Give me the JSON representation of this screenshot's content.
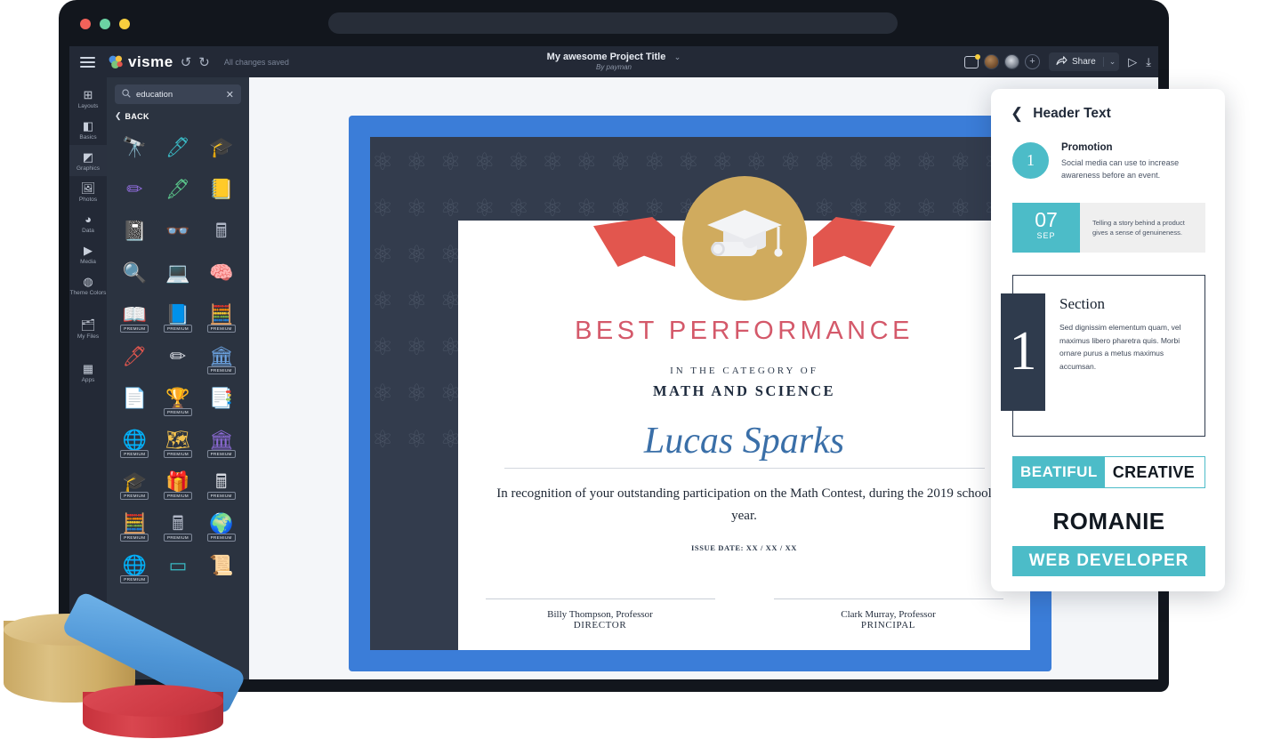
{
  "window": {
    "traffic_lights": [
      "close-red",
      "minimize-green",
      "maximize-yellow"
    ],
    "url_value": ""
  },
  "topbar": {
    "menu_icon": "hamburger-icon",
    "brand": "visme",
    "undo_icon": "↺",
    "redo_icon": "↻",
    "save_status": "All changes saved",
    "project_title": "My awesome Project Title",
    "project_caret": "⌄",
    "project_subtitle": "By payman",
    "comment_icon": "comment-icon",
    "add_user_icon": "+",
    "share_label": "Share",
    "share_caret": "⌄",
    "preview_icon": "▷",
    "download_icon": "⤓"
  },
  "rail": {
    "items": [
      {
        "label": "Layouts",
        "icon": "⊞",
        "active": false
      },
      {
        "label": "Basics",
        "icon": "◧",
        "active": false
      },
      {
        "label": "Graphics",
        "icon": "◩",
        "active": true
      },
      {
        "label": "Photos",
        "icon": "🖼",
        "active": false
      },
      {
        "label": "Data",
        "icon": "◕",
        "active": false
      },
      {
        "label": "Media",
        "icon": "▶",
        "active": false
      },
      {
        "label": "Theme Colors",
        "icon": "◍",
        "active": false
      },
      {
        "label": "My Files",
        "icon": "🗂",
        "active": false
      },
      {
        "label": "Apps",
        "icon": "▦",
        "active": false
      }
    ]
  },
  "assets": {
    "search_value": "education",
    "search_placeholder": "Search",
    "search_icon": "search-icon",
    "clear_icon": "✕",
    "back_label": "BACK",
    "back_icon": "chevron-left-icon",
    "premium_badge": "PREMIUM",
    "items": [
      {
        "name": "telescope-icon",
        "glyph": "🔭",
        "premium": false
      },
      {
        "name": "pen-icon",
        "glyph": "🖊",
        "premium": false
      },
      {
        "name": "graduation-cap-icon",
        "glyph": "🎓",
        "premium": false
      },
      {
        "name": "pencil-icon",
        "glyph": "✏",
        "premium": false
      },
      {
        "name": "fountain-pen-icon",
        "glyph": "🖋",
        "premium": false
      },
      {
        "name": "books-stack-icon",
        "glyph": "📒",
        "premium": false
      },
      {
        "name": "notebook-icon",
        "glyph": "📓",
        "premium": false
      },
      {
        "name": "glasses-icon",
        "glyph": "👓",
        "premium": false
      },
      {
        "name": "calculator-icon",
        "glyph": "🖩",
        "premium": false
      },
      {
        "name": "research-icon",
        "glyph": "🔍",
        "premium": false
      },
      {
        "name": "laptop-icon",
        "glyph": "💻",
        "premium": false
      },
      {
        "name": "brain-head-icon",
        "glyph": "🧠",
        "premium": false
      },
      {
        "name": "open-book-icon",
        "glyph": "📖",
        "premium": true
      },
      {
        "name": "textbook-icon",
        "glyph": "📘",
        "premium": true
      },
      {
        "name": "abacus-icon",
        "glyph": "🧮",
        "premium": true
      },
      {
        "name": "scissors-pen-icon",
        "glyph": "🖊",
        "premium": false
      },
      {
        "name": "yellow-pencil-icon",
        "glyph": "✏",
        "premium": false
      },
      {
        "name": "podium-icon",
        "glyph": "🏛",
        "premium": true
      },
      {
        "name": "paper-sheet-icon",
        "glyph": "📄",
        "premium": false
      },
      {
        "name": "trophy-icon",
        "glyph": "🏆",
        "premium": true
      },
      {
        "name": "documents-icon",
        "glyph": "📑",
        "premium": false
      },
      {
        "name": "globe-grid-icon",
        "glyph": "🌐",
        "premium": true
      },
      {
        "name": "world-map-icon",
        "glyph": "🗺",
        "premium": true
      },
      {
        "name": "bank-building-icon",
        "glyph": "🏛",
        "premium": true
      },
      {
        "name": "cap-glasses-icon",
        "glyph": "🎓",
        "premium": true
      },
      {
        "name": "gift-book-icon",
        "glyph": "🎁",
        "premium": true
      },
      {
        "name": "calculator-green-icon",
        "glyph": "🖩",
        "premium": true
      },
      {
        "name": "abacus-green-icon",
        "glyph": "🧮",
        "premium": true
      },
      {
        "name": "calculator-teal-icon",
        "glyph": "🖩",
        "premium": true
      },
      {
        "name": "earth-purple-icon",
        "glyph": "🌍",
        "premium": true
      },
      {
        "name": "globe-white-icon",
        "glyph": "🌐",
        "premium": true
      },
      {
        "name": "whiteboard-icon",
        "glyph": "▭",
        "premium": false
      },
      {
        "name": "scroll-icon",
        "glyph": "📜",
        "premium": false
      }
    ]
  },
  "certificate": {
    "medal_icon": "graduation-medal-icon",
    "title": "BEST PERFORMANCE",
    "category_label": "IN THE CATEGORY OF",
    "category": "MATH AND SCIENCE",
    "recipient": "Lucas Sparks",
    "body": "In recognition of your outstanding participation on the Math Contest, during the 2019 school year.",
    "issue_date": "ISSUE DATE: XX / XX / XX",
    "signatures": [
      {
        "name": "Billy Thompson, Professor",
        "role": "DIRECTOR"
      },
      {
        "name": "Clark Murray, Professor",
        "role": "PRINCIPAL"
      }
    ],
    "colors": {
      "border_blue": "#3b7dd8",
      "inner_navy": "#333c4d",
      "title_red": "#d4596a",
      "name_blue": "#3a6fa8",
      "medal_gold": "#d0ab5e",
      "ribbon_red": "#e2564e"
    }
  },
  "right_panel": {
    "back_icon": "chevron-left-icon",
    "title": "Header Text",
    "accent_color": "#4cbcc8",
    "promotion": {
      "number": "1",
      "heading": "Promotion",
      "description": "Social media can use to increase awareness before an event."
    },
    "date_card": {
      "day": "07",
      "month": "SEP",
      "text": "Telling a story behind a product gives a sense of genuineness."
    },
    "section_card": {
      "number": "1",
      "title": "Section",
      "text": "Sed dignissim elementum quam, vel maximus libero pharetra quis. Morbi ornare purus a metus maximus accumsan."
    },
    "beatiful_card": {
      "left": "BEATIFUL",
      "right": "CREATIVE"
    },
    "romanie_card": {
      "title": "ROMANIE",
      "subtitle": "WEB DEVELOPER"
    }
  }
}
